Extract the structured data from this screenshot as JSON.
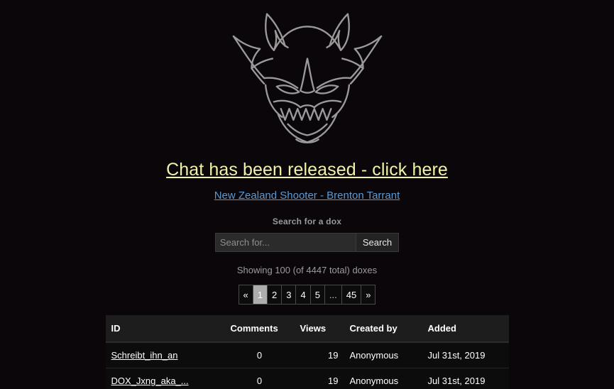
{
  "site": {
    "logo_alt": "demon-head-logo"
  },
  "headline": {
    "text": "Chat has been released - click here",
    "color": "#f2f2a6"
  },
  "sublink": {
    "text": "New Zealand Shooter - Brenton Tarrant",
    "color": "#5b9bd5"
  },
  "search": {
    "label": "Search for a dox",
    "placeholder": "Search for...",
    "value": "",
    "button_label": "Search"
  },
  "results": {
    "showing_text": "Showing 100 (of 4447 total) doxes",
    "count_shown": 100,
    "count_total": 4447
  },
  "pagination": {
    "prev_label": "«",
    "next_label": "»",
    "ellipsis_label": "...",
    "active_page": "1",
    "active_color": "#adadad",
    "pages": [
      "1",
      "2",
      "3",
      "4",
      "5",
      "...",
      "45"
    ]
  },
  "table": {
    "columns": [
      "ID",
      "Comments",
      "Views",
      "Created by",
      "Added"
    ],
    "rows": [
      {
        "id": "Schreibt_ihn_an",
        "comments": "0",
        "views": "19",
        "created_by": "Anonymous",
        "added": "Jul 31st, 2019"
      },
      {
        "id": "DOX_Jxng_aka_...",
        "comments": "0",
        "views": "19",
        "created_by": "Anonymous",
        "added": "Jul 31st, 2019"
      }
    ]
  }
}
